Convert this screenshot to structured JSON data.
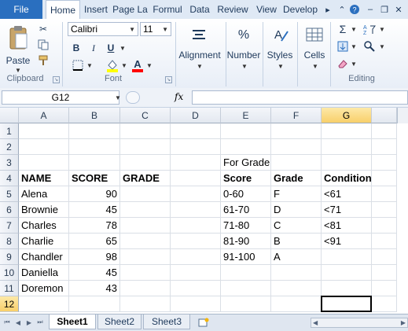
{
  "tabs": {
    "file": "File",
    "items": [
      "Home",
      "Insert",
      "Page La",
      "Formul",
      "Data",
      "Review",
      "View",
      "Develop"
    ],
    "active": "Home"
  },
  "ribbon": {
    "clipboard": {
      "paste_label": "Paste",
      "group_label": "Clipboard"
    },
    "font": {
      "font_name": "Calibri",
      "font_size": "11",
      "bold": "B",
      "italic": "I",
      "underline": "U",
      "fill_color": "#ffff00",
      "font_color": "#ff0000",
      "group_label": "Font"
    },
    "alignment": {
      "label": "Alignment"
    },
    "number": {
      "symbol": "%",
      "label": "Number"
    },
    "styles": {
      "label": "Styles"
    },
    "cells": {
      "label": "Cells"
    },
    "editing": {
      "sigma": "Σ",
      "group_label": "Editing"
    }
  },
  "formula_bar": {
    "name_box": "G12",
    "fx": "fx",
    "formula": ""
  },
  "grid": {
    "columns": [
      "A",
      "B",
      "C",
      "D",
      "E",
      "F",
      "G"
    ],
    "selected_column": "G",
    "selected_row": "12",
    "rows": [
      {
        "n": "1",
        "cells": [
          "",
          "",
          "",
          "",
          "",
          "",
          ""
        ]
      },
      {
        "n": "2",
        "cells": [
          "",
          "",
          "",
          "",
          "",
          "",
          ""
        ]
      },
      {
        "n": "3",
        "cells": [
          "",
          "",
          "",
          "",
          "For Grade",
          "",
          ""
        ]
      },
      {
        "n": "4",
        "cells": [
          "NAME",
          "SCORE",
          "GRADE",
          "",
          "Score",
          "Grade",
          "Condition"
        ]
      },
      {
        "n": "5",
        "cells": [
          "Alena",
          "90",
          "",
          "",
          "0-60",
          "F",
          "<61"
        ]
      },
      {
        "n": "6",
        "cells": [
          "Brownie",
          "45",
          "",
          "",
          "61-70",
          "D",
          "<71"
        ]
      },
      {
        "n": "7",
        "cells": [
          "Charles",
          "78",
          "",
          "",
          "71-80",
          "C",
          "<81"
        ]
      },
      {
        "n": "8",
        "cells": [
          "Charlie",
          "65",
          "",
          "",
          "81-90",
          "B",
          "<91"
        ]
      },
      {
        "n": "9",
        "cells": [
          "Chandler",
          "98",
          "",
          "",
          "91-100",
          "A",
          ""
        ]
      },
      {
        "n": "10",
        "cells": [
          "Daniella",
          "45",
          "",
          "",
          "",
          "",
          ""
        ]
      },
      {
        "n": "11",
        "cells": [
          "Doremon",
          "43",
          "",
          "",
          "",
          "",
          ""
        ]
      },
      {
        "n": "12",
        "cells": [
          "",
          "",
          "",
          "",
          "",
          "",
          ""
        ]
      }
    ]
  },
  "sheets": {
    "tabs": [
      "Sheet1",
      "Sheet2",
      "Sheet3"
    ],
    "active": "Sheet1"
  }
}
